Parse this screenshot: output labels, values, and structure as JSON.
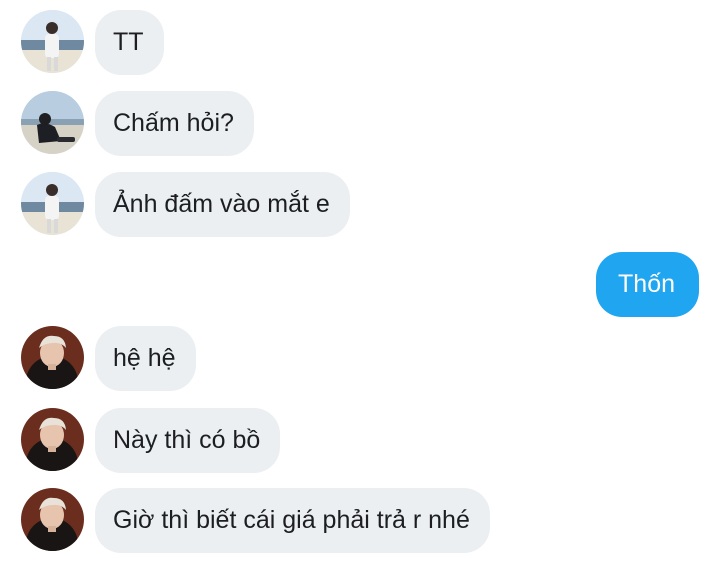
{
  "messages": [
    {
      "direction": "in",
      "sender": "a",
      "text": "TT"
    },
    {
      "direction": "in",
      "sender": "b",
      "text": "Chấm hỏi?"
    },
    {
      "direction": "in",
      "sender": "a",
      "text": "Ảnh đấm vào mắt e"
    },
    {
      "direction": "out",
      "sender": "me",
      "text": "Thốn"
    },
    {
      "direction": "in",
      "sender": "c",
      "text": "hệ hệ"
    },
    {
      "direction": "in",
      "sender": "c",
      "text": "Này thì có bồ"
    },
    {
      "direction": "in",
      "sender": "c",
      "text": "Giờ thì biết cái giá phải trả r nhé"
    }
  ],
  "colors": {
    "incoming_bubble": "#eceff1",
    "outgoing_bubble": "#20a5f0",
    "incoming_text": "#1c1e21",
    "outgoing_text": "#ffffff"
  }
}
